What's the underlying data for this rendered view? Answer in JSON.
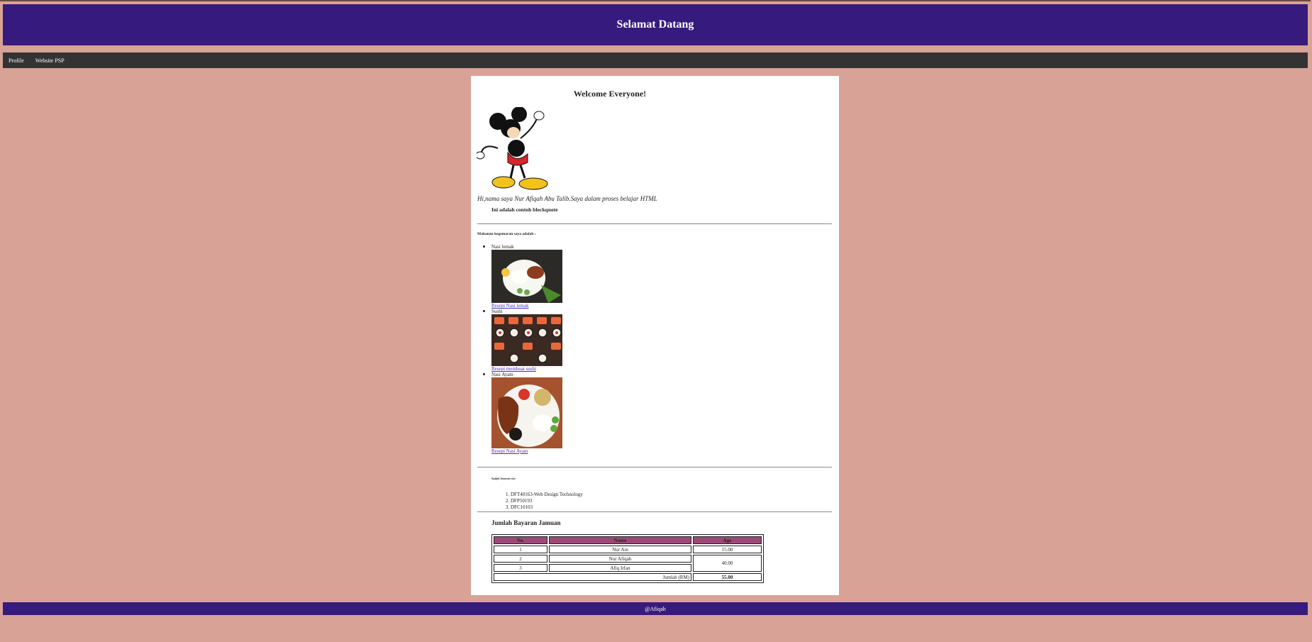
{
  "header": {
    "title": "Selamat Datang"
  },
  "nav": {
    "items": [
      "Profile",
      "Website PSP"
    ]
  },
  "main": {
    "welcome": "Welcome Everyone!",
    "intro": "Hi,nama saya Nur Afiqah Abu Talib.Saya dalam proses belajar HTML",
    "blockquote": "Ini adalah contoh blockquote",
    "favourite_heading": "Makanan kegemaran saya adalah :",
    "foods": [
      {
        "name": "Nasi lemak",
        "link": "Resepi Nasi lemak"
      },
      {
        "name": "Sushi",
        "link": "Resepi membuat sushi"
      },
      {
        "name": "Nasi Ayam",
        "link": "Resepi Nasi Ayam"
      }
    ],
    "subjects_heading": "Subjek Semester ini:",
    "subjects": [
      "1. DFT40163-Web Design Technology",
      "2. DFP50193",
      "3. DFC10103"
    ],
    "fee_title": "Jumlah Bayaran Jamuan",
    "table": {
      "headers": [
        "No.",
        "Name",
        "Age"
      ],
      "rows": [
        {
          "no": "1",
          "name": "Nur Ain",
          "age": "15.00"
        },
        {
          "no": "2",
          "name": "Nur Afiqah",
          "age": "40.00"
        },
        {
          "no": "3",
          "name": "Afiq Irfan"
        }
      ],
      "total_label": "Jumlah (RM)",
      "total_value": "55.00"
    }
  },
  "footer": {
    "text": "@Afiqah"
  },
  "colors": {
    "banner": "#361a7d",
    "nav": "#333333",
    "background": "#d8a297",
    "table_header": "#9b4a78"
  }
}
